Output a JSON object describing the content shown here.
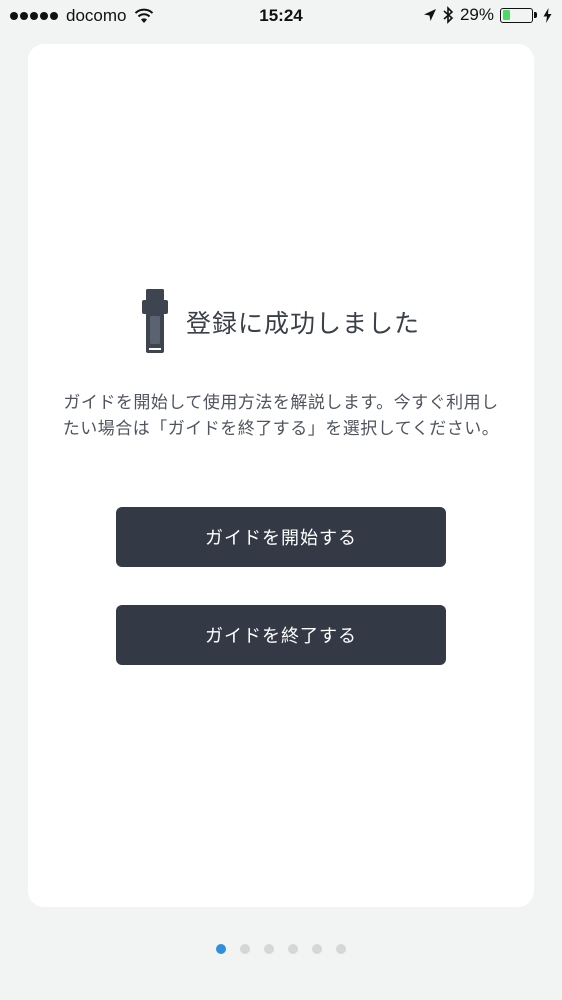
{
  "status_bar": {
    "carrier": "docomo",
    "time": "15:24",
    "battery_percent": "29%",
    "battery_level": 0.29,
    "signal_bars": 5,
    "icons": [
      "signal-dots-icon",
      "wifi-icon",
      "location-arrow-icon",
      "bluetooth-icon",
      "battery-icon",
      "charging-bolt-icon"
    ],
    "battery_color": "#4cd964"
  },
  "card": {
    "title": "登録に成功しました",
    "title_icon": "band-device-icon",
    "description": "ガイドを開始して使用方法を解説します。今すぐ利用したい場合は「ガイドを終了する」を選択してください。",
    "buttons": {
      "start_label": "ガイドを開始する",
      "end_label": "ガイドを終了する"
    },
    "button_color": "#333a46"
  },
  "pager": {
    "total_pages": 6,
    "current_page": 1,
    "active_color": "#2f8fd8"
  }
}
